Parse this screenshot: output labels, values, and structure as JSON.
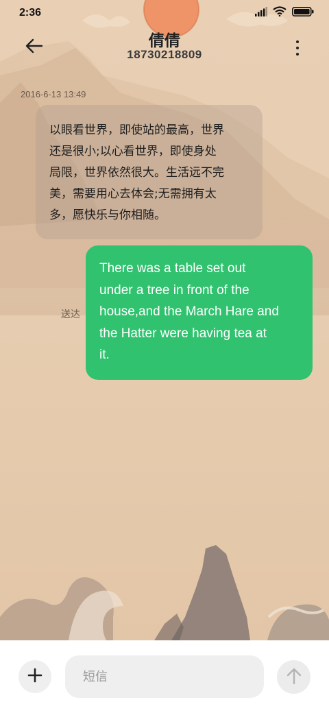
{
  "status_bar": {
    "time": "2:36",
    "icons": [
      "signal-icon",
      "wifi-icon",
      "battery-icon"
    ]
  },
  "header": {
    "back_icon": "back-arrow-icon",
    "contact_name": "倩倩",
    "contact_number": "18730218809",
    "more_icon": "more-vertical-icon"
  },
  "conversation": {
    "timestamp": "2016-6-13 13:49",
    "messages": [
      {
        "direction": "incoming",
        "lines": [
          "以眼看世界，即使站的最高，世界",
          "还是很小;以心看世界，即使身处",
          "局限，世界依然很大。生活远不完",
          "美，需要用心去体会;无需拥有太",
          "多，愿快乐与你相随。"
        ]
      },
      {
        "direction": "outgoing",
        "lines": [
          "There was a table set out",
          "under a tree in front of the",
          "house,and the March Hare and",
          "the Hatter were having tea at",
          "it."
        ],
        "status": "送达",
        "bubble_color": "#31c26f"
      }
    ]
  },
  "input_bar": {
    "add_icon": "plus-icon",
    "placeholder": "短信",
    "value": "",
    "send_icon": "send-arrow-icon"
  }
}
